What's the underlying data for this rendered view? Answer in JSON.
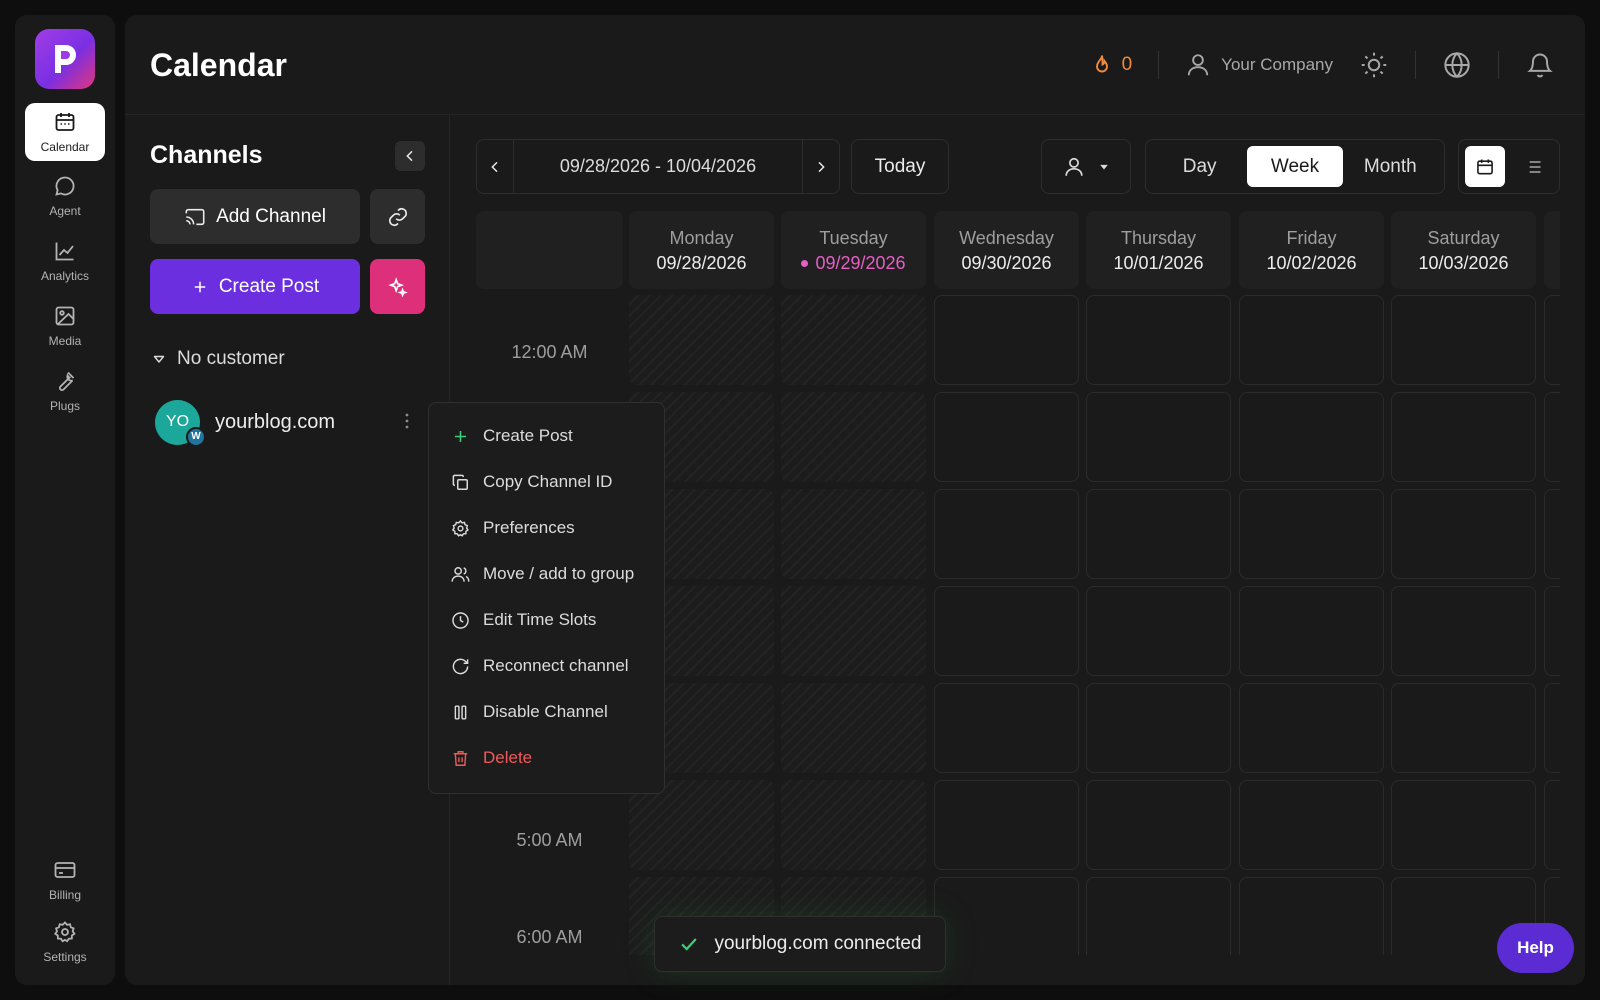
{
  "sidebar": {
    "items": [
      {
        "label": "Calendar",
        "icon": "calendar-icon",
        "active": true
      },
      {
        "label": "Agent",
        "icon": "chat-bubble-icon"
      },
      {
        "label": "Analytics",
        "icon": "line-chart-icon"
      },
      {
        "label": "Media",
        "icon": "image-icon"
      },
      {
        "label": "Plugs",
        "icon": "wrench-icon"
      }
    ],
    "bottom_items": [
      {
        "label": "Billing",
        "icon": "credit-card-icon"
      },
      {
        "label": "Settings",
        "icon": "gear-icon"
      }
    ]
  },
  "header": {
    "title": "Calendar",
    "streak_count": "0",
    "company": "Your Company"
  },
  "channels": {
    "title": "Channels",
    "add_channel_label": "Add Channel",
    "create_post_label": "Create Post",
    "customer_label": "No customer",
    "items": [
      {
        "initials": "YO",
        "name": "yourblog.com",
        "platform_badge": "W"
      }
    ]
  },
  "calendar": {
    "date_range": "09/28/2026 - 10/04/2026",
    "today_label": "Today",
    "views": [
      "Day",
      "Week",
      "Month"
    ],
    "active_view": "Week",
    "days": [
      {
        "name": "Monday",
        "date": "09/28/2026"
      },
      {
        "name": "Tuesday",
        "date": "09/29/2026",
        "today": true
      },
      {
        "name": "Wednesday",
        "date": "09/30/2026"
      },
      {
        "name": "Thursday",
        "date": "10/01/2026"
      },
      {
        "name": "Friday",
        "date": "10/02/2026"
      },
      {
        "name": "Saturday",
        "date": "10/03/2026"
      }
    ],
    "time_labels": [
      "12:00 AM",
      "5:00 AM",
      "6:00 AM"
    ]
  },
  "context_menu": {
    "items": [
      {
        "label": "Create Post",
        "icon": "plus-icon"
      },
      {
        "label": "Copy Channel ID",
        "icon": "copy-icon"
      },
      {
        "label": "Preferences",
        "icon": "gear-icon"
      },
      {
        "label": "Move / add to group",
        "icon": "users-icon"
      },
      {
        "label": "Edit Time Slots",
        "icon": "clock-icon"
      },
      {
        "label": "Reconnect channel",
        "icon": "refresh-icon"
      },
      {
        "label": "Disable Channel",
        "icon": "pause-icon"
      },
      {
        "label": "Delete",
        "icon": "trash-icon",
        "danger": true
      }
    ]
  },
  "toast": {
    "message": "yourblog.com connected"
  },
  "help_label": "Help",
  "colors": {
    "accent_purple": "#6b2fe0",
    "accent_pink": "#de2f7a",
    "today_pink": "#e65ec6",
    "danger": "#f0595a",
    "streak_orange": "#f08a3c",
    "success_green": "#3ccf78"
  }
}
